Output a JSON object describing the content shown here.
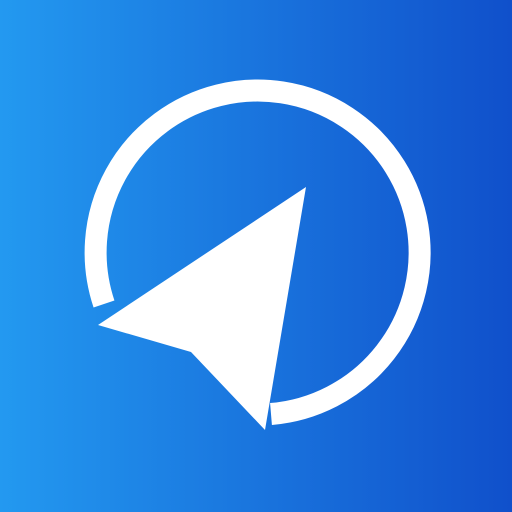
{
  "app_icon": {
    "icon": "navigation-arrow-in-ring-icon",
    "colors": {
      "gradient_start": "#2399F0",
      "gradient_end": "#1050CB",
      "foreground": "#FFFFFF"
    }
  }
}
